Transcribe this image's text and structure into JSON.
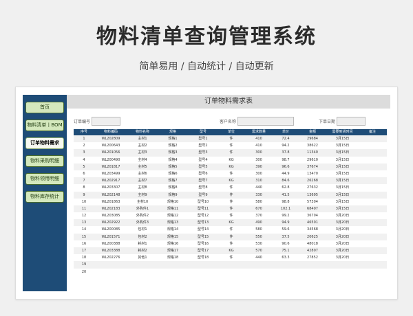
{
  "hero": {
    "title": "物料清单查询管理系统",
    "subtitle": "简单易用 / 自动统计 / 自动更新"
  },
  "sidebar": {
    "items": [
      {
        "label": "首页",
        "active": false
      },
      {
        "label": "物料清单丨BOM",
        "active": false
      },
      {
        "label": "订单物料需求",
        "active": true
      },
      {
        "label": "物料采购明细",
        "active": false
      },
      {
        "label": "物料领用明细",
        "active": false
      },
      {
        "label": "物料库存统计",
        "active": false
      }
    ]
  },
  "main": {
    "title": "订单物料需求表",
    "filters": {
      "order_label": "订单编号",
      "customer_label": "客户名称",
      "date_label": "下单日期"
    },
    "columns": [
      "序号",
      "物料编码",
      "物料名称",
      "规格",
      "型号",
      "单位",
      "需求数量",
      "单价",
      "金额",
      "需要到货时间",
      "备注"
    ],
    "rows": [
      [
        "1",
        "WL202809",
        "主材1",
        "规格1",
        "型号1",
        "件",
        "410",
        "72.4",
        "29684",
        "3月15日",
        ""
      ],
      [
        "2",
        "WL200643",
        "主材2",
        "规格2",
        "型号2",
        "件",
        "410",
        "94.2",
        "38622",
        "3月15日",
        ""
      ],
      [
        "3",
        "WL201056",
        "主材3",
        "规格3",
        "型号3",
        "件",
        "300",
        "37.8",
        "11340",
        "3月15日",
        ""
      ],
      [
        "4",
        "WL200490",
        "主材4",
        "规格4",
        "型号4",
        "KG",
        "300",
        "98.7",
        "29610",
        "3月15日",
        ""
      ],
      [
        "5",
        "WL201817",
        "主材5",
        "规格5",
        "型号5",
        "KG",
        "390",
        "96.6",
        "37674",
        "3月15日",
        ""
      ],
      [
        "6",
        "WL203499",
        "主材6",
        "规格6",
        "型号6",
        "件",
        "300",
        "44.9",
        "13470",
        "3月15日",
        ""
      ],
      [
        "7",
        "WL202917",
        "主材7",
        "规格7",
        "型号7",
        "KG",
        "310",
        "84.6",
        "26268",
        "3月15日",
        ""
      ],
      [
        "8",
        "WL203307",
        "主材8",
        "规格8",
        "型号8",
        "件",
        "440",
        "62.8",
        "27632",
        "3月15日",
        ""
      ],
      [
        "9",
        "WL202148",
        "主材9",
        "规格9",
        "型号9",
        "件",
        "330",
        "41.5",
        "13695",
        "3月15日",
        ""
      ],
      [
        "10",
        "WL201863",
        "主材10",
        "规格10",
        "型号10",
        "件",
        "580",
        "98.8",
        "57304",
        "3月15日",
        ""
      ],
      [
        "11",
        "WL202183",
        "外购件1",
        "规格11",
        "型号11",
        "件",
        "670",
        "102.1",
        "68407",
        "3月15日",
        ""
      ],
      [
        "12",
        "WL203085",
        "外购件2",
        "规格12",
        "型号12",
        "件",
        "370",
        "99.2",
        "36704",
        "3月20日",
        ""
      ],
      [
        "13",
        "WL202922",
        "外购件3",
        "规格13",
        "型号13",
        "KG",
        "490",
        "94.9",
        "46501",
        "3月20日",
        ""
      ],
      [
        "14",
        "WL200085",
        "包材1",
        "规格14",
        "型号14",
        "件",
        "580",
        "59.6",
        "34568",
        "3月20日",
        ""
      ],
      [
        "15",
        "WL201571",
        "包材2",
        "规格15",
        "型号15",
        "件",
        "550",
        "37.5",
        "20625",
        "3月20日",
        ""
      ],
      [
        "16",
        "WL200388",
        "耗材1",
        "规格16",
        "型号16",
        "件",
        "530",
        "90.6",
        "48018",
        "3月20日",
        ""
      ],
      [
        "17",
        "WL203388",
        "耗材2",
        "规格17",
        "型号17",
        "KG",
        "570",
        "75.1",
        "42807",
        "3月20日",
        ""
      ],
      [
        "18",
        "WL202276",
        "其他1",
        "规格18",
        "型号18",
        "件",
        "440",
        "63.3",
        "27852",
        "3月20日",
        ""
      ],
      [
        "19",
        "",
        "",
        "",
        "",
        "",
        "",
        "",
        "",
        "",
        ""
      ],
      [
        "20",
        "",
        "",
        "",
        "",
        "",
        "",
        "",
        "",
        "",
        ""
      ]
    ]
  }
}
